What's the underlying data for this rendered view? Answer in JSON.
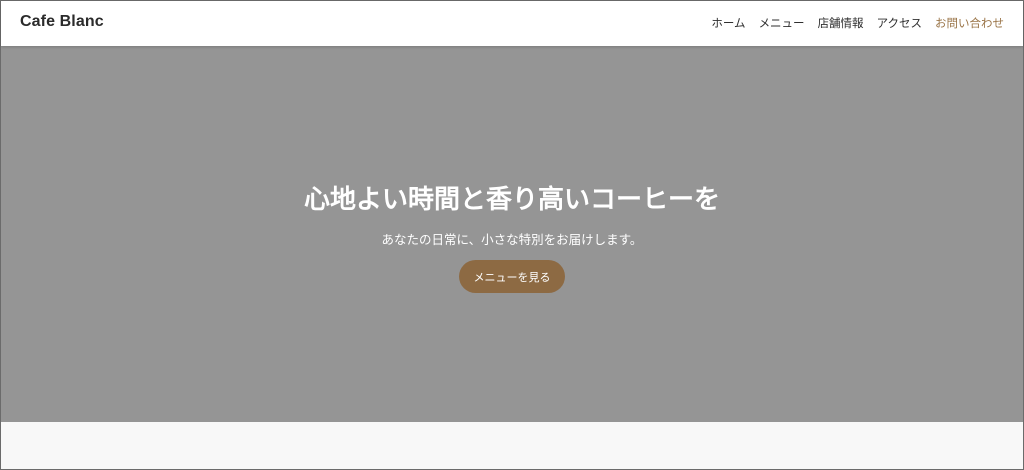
{
  "header": {
    "logo": "Cafe Blanc",
    "nav": [
      {
        "label": "ホーム"
      },
      {
        "label": "メニュー"
      },
      {
        "label": "店舗情報"
      },
      {
        "label": "アクセス"
      },
      {
        "label": "お問い合わせ"
      }
    ]
  },
  "hero": {
    "title": "心地よい時間と香り高いコーヒーを",
    "subtitle": "あなたの日常に、小さな特別をお届けします。",
    "cta_label": "メニューを見る"
  },
  "colors": {
    "accent": "#9a7447",
    "button": "#8d6a43",
    "hero_bg": "#959595"
  }
}
